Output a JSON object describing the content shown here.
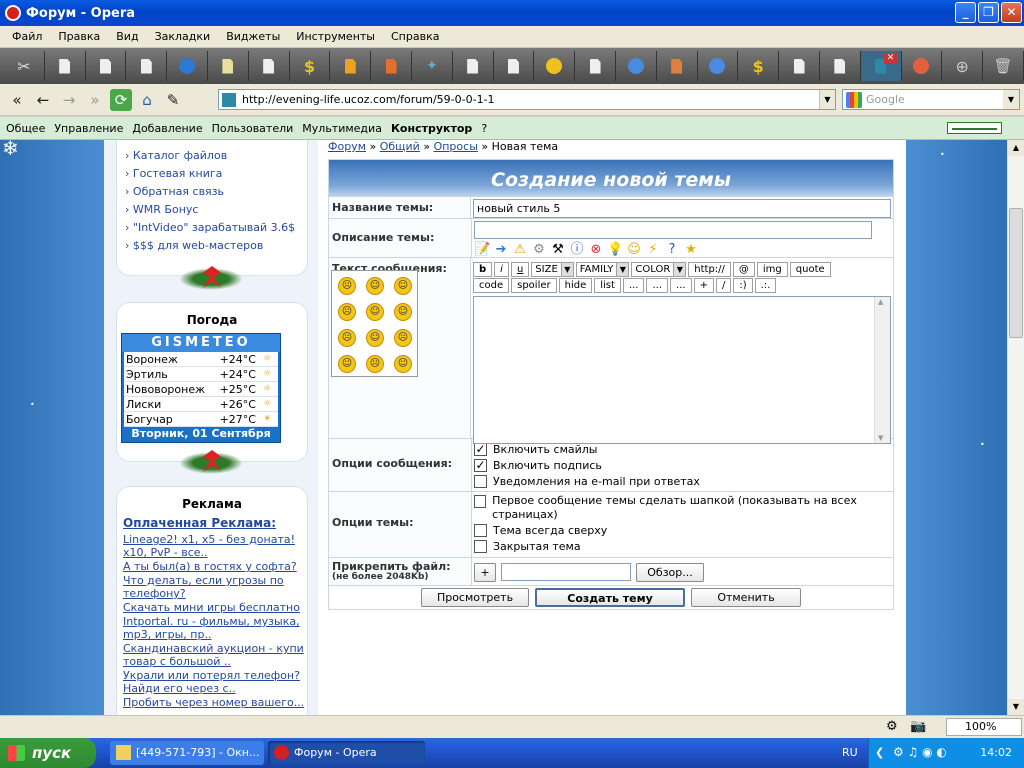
{
  "window": {
    "title": "Форум - Opera"
  },
  "menu": [
    "Файл",
    "Правка",
    "Вид",
    "Закладки",
    "Виджеты",
    "Инструменты",
    "Справка"
  ],
  "address": {
    "url": "http://evening-life.ucoz.com/forum/59-0-0-1-1"
  },
  "search": {
    "placeholder": "Google"
  },
  "ucoz_menu": [
    "Общее",
    "Управление",
    "Добавление",
    "Пользователи",
    "Мультимедиа",
    "Конструктор",
    "?"
  ],
  "sidebar": {
    "links": [
      "Каталог файлов",
      "Гостевая книга",
      "Обратная связь",
      "WMR Бонус",
      "\"IntVideo\" зарабатывай 3.6$",
      "$$$ для web-мастеров"
    ],
    "weather": {
      "title": "Погода",
      "brand": "GISMETEO",
      "rows": [
        {
          "city": "Воронеж",
          "temp": "+24°C"
        },
        {
          "city": "Эртиль",
          "temp": "+24°C"
        },
        {
          "city": "Нововоронеж",
          "temp": "+25°C"
        },
        {
          "city": "Лиски",
          "temp": "+26°C"
        },
        {
          "city": "Богучар",
          "temp": "+27°C"
        }
      ],
      "date": "Вторник, 01 Сентября"
    },
    "ads": {
      "title": "Реклама",
      "header": "Оплаченная Реклама:",
      "items": [
        "Lineage2! x1, x5 - без доната! x10, PvP - все..",
        "А ты был(а) в гостях у софта?",
        "Что делать, если угрозы по телефону?",
        "Скачать мини игры бесплатно",
        "Intportal. ru - фильмы, музыка, mp3, игры, пр..",
        "Скандинавский аукцион - купи товар с большой ..",
        "Украли или потерял телефон? Найди его через с..",
        "Пробить через номер вашего..."
      ]
    }
  },
  "breadcrumb": {
    "forum": "Форум",
    "general": "Общий",
    "polls": "Опросы",
    "current": "Новая тема"
  },
  "form": {
    "header": "Создание новой темы",
    "title_label": "Название темы:",
    "title_value": "новый стиль 5",
    "desc_label": "Описание темы:",
    "desc_value": "",
    "message_label": "Текст сообщения:",
    "bbcodes_row1": [
      "b",
      "i",
      "u",
      "SIZE",
      "FAMILY",
      "COLOR",
      "http://",
      "@",
      "img",
      "quote"
    ],
    "bbcodes_row2": [
      "code",
      "spoiler",
      "hide",
      "list",
      "...",
      "...",
      "...",
      "+",
      "/",
      ":)",
      ".:."
    ],
    "msg_options_label": "Опции сообщения:",
    "opt_smiles": "Включить смайлы",
    "opt_signature": "Включить подпись",
    "opt_email": "Уведомления на e-mail при ответах",
    "topic_options_label": "Опции темы:",
    "opt_pin_first": "Первое сообщение темы сделать шапкой (показывать на всех страницах)",
    "opt_top": "Тема всегда сверху",
    "opt_closed": "Закрытая тема",
    "attach_label": "Прикрепить файл:",
    "attach_note": "(не более 2048Kb)",
    "attach_plus": "+",
    "browse": "Обзор...",
    "preview": "Просмотреть",
    "submit": "Создать тему",
    "cancel": "Отменить"
  },
  "status": {
    "zoom": "100%"
  },
  "taskbar": {
    "start": "пуск",
    "task1": "[449-571-793] - Окн...",
    "task2": "Форум - Opera",
    "lang": "RU",
    "clock": "14:02"
  }
}
